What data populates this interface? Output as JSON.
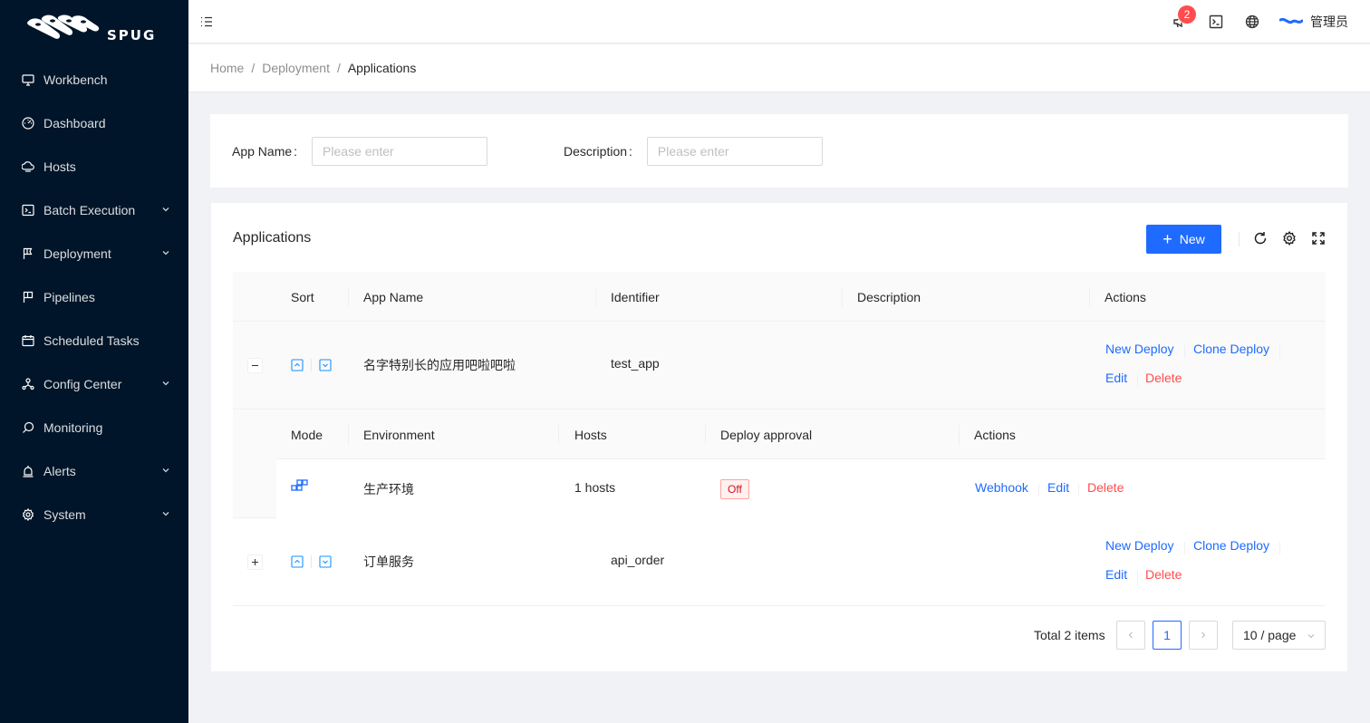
{
  "brand": {
    "name": "SPUG"
  },
  "sidebar": {
    "items": [
      {
        "label": "Workbench",
        "icon": "desktop-icon",
        "has_children": false
      },
      {
        "label": "Dashboard",
        "icon": "dashboard-icon",
        "has_children": false
      },
      {
        "label": "Hosts",
        "icon": "cloud-server-icon",
        "has_children": false
      },
      {
        "label": "Batch Execution",
        "icon": "terminal-icon",
        "has_children": true
      },
      {
        "label": "Deployment",
        "icon": "flag-icon",
        "has_children": true
      },
      {
        "label": "Pipelines",
        "icon": "pipeline-icon",
        "has_children": false
      },
      {
        "label": "Scheduled Tasks",
        "icon": "schedule-icon",
        "has_children": false
      },
      {
        "label": "Config Center",
        "icon": "deployment-unit-icon",
        "has_children": true
      },
      {
        "label": "Monitoring",
        "icon": "monitor-icon",
        "has_children": false
      },
      {
        "label": "Alerts",
        "icon": "alert-icon",
        "has_children": true
      },
      {
        "label": "System",
        "icon": "setting-icon",
        "has_children": true
      }
    ]
  },
  "header": {
    "notification_count": "2",
    "user_name": "管理员"
  },
  "breadcrumb": [
    "Home",
    "Deployment",
    "Applications"
  ],
  "search": {
    "app_name_label": "App Name",
    "app_name_placeholder": "Please enter",
    "description_label": "Description",
    "description_placeholder": "Please enter"
  },
  "table": {
    "title": "Applications",
    "new_button": "New",
    "columns": [
      "Sort",
      "App Name",
      "Identifier",
      "Description",
      "Actions"
    ],
    "rows": [
      {
        "name": "名字特别长的应用吧啦吧啦",
        "identifier": "test_app",
        "description": "",
        "expanded": true,
        "actions": {
          "new_deploy": "New Deploy",
          "clone_deploy": "Clone Deploy",
          "edit": "Edit",
          "delete": "Delete"
        }
      },
      {
        "name": "订单服务",
        "identifier": "api_order",
        "description": "",
        "expanded": false,
        "actions": {
          "new_deploy": "New Deploy",
          "clone_deploy": "Clone Deploy",
          "edit": "Edit",
          "delete": "Delete"
        }
      }
    ],
    "sub": {
      "columns": [
        "Mode",
        "Environment",
        "Hosts",
        "Deploy approval",
        "Actions"
      ],
      "rows": [
        {
          "mode_icon": "build-icon",
          "environment": "生产环境",
          "hosts": "1 hosts",
          "approval": "Off",
          "actions": {
            "webhook": "Webhook",
            "edit": "Edit",
            "delete": "Delete"
          }
        }
      ]
    }
  },
  "pagination": {
    "total": "Total 2 items",
    "current_page": "1",
    "page_size": "10 / page"
  },
  "colors": {
    "primary": "#1f6bff",
    "danger": "#ff4d4f",
    "sidebar_bg": "#001529"
  }
}
